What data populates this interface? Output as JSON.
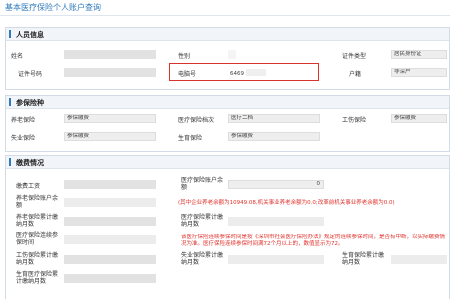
{
  "page": {
    "title": "基本医疗保险个人账户查询"
  },
  "personal": {
    "header": "人员信息",
    "name_label": "姓名",
    "gender_label": "性别",
    "id_type_label": "证件类型",
    "id_type_value": "居民身份证",
    "id_no_label": "证件号码",
    "pc_no_label": "电脑号",
    "pc_no_value": "6469",
    "huji_label": "户籍",
    "huji_value": "非深户"
  },
  "insurance": {
    "header": "参保险种",
    "pension_label": "养老保险",
    "pension_value": "参保缴费",
    "medical_tier_label": "医疗保险档次",
    "medical_tier_value": "医疗二档",
    "injury_label": "工伤保险",
    "injury_value": "参保缴费",
    "unemployment_label": "失业保险",
    "unemployment_value": "参保缴费",
    "maternity_label": "生育保险",
    "maternity_value": "参保缴费"
  },
  "payment": {
    "header": "缴费情况",
    "wage_label": "缴费工资",
    "med_balance_label": "医疗保险账户余额",
    "med_balance_value": "0",
    "pension_account_label": "养老保险账户余额",
    "pension_note": "(其中企业养老余额为10949.08,机关事业养老余额为0.0;改革前机关事业养老余额为0.0)",
    "pension_months_label": "养老保险累计缴纳月数",
    "medical_months_label": "医疗保险累计缴纳月数",
    "medical_cont_label": "医疗保险连续参保时间",
    "medical_note": "该医疗保险连续参保时间是按《深圳市社会医疗保险办法》规定的连续参保时间，是否有中断，以实际缴费情况为准。医疗保险连续参保时间满72个月以上的，数值显示为72。",
    "injury_months_label": "工伤保险累计缴纳月数",
    "unemp_months_label": "失业保险累计缴纳月数",
    "maternity_months_label": "生育保险累计缴纳月数",
    "maternity2_label": "生育医疗保险累计缴纳月数"
  }
}
